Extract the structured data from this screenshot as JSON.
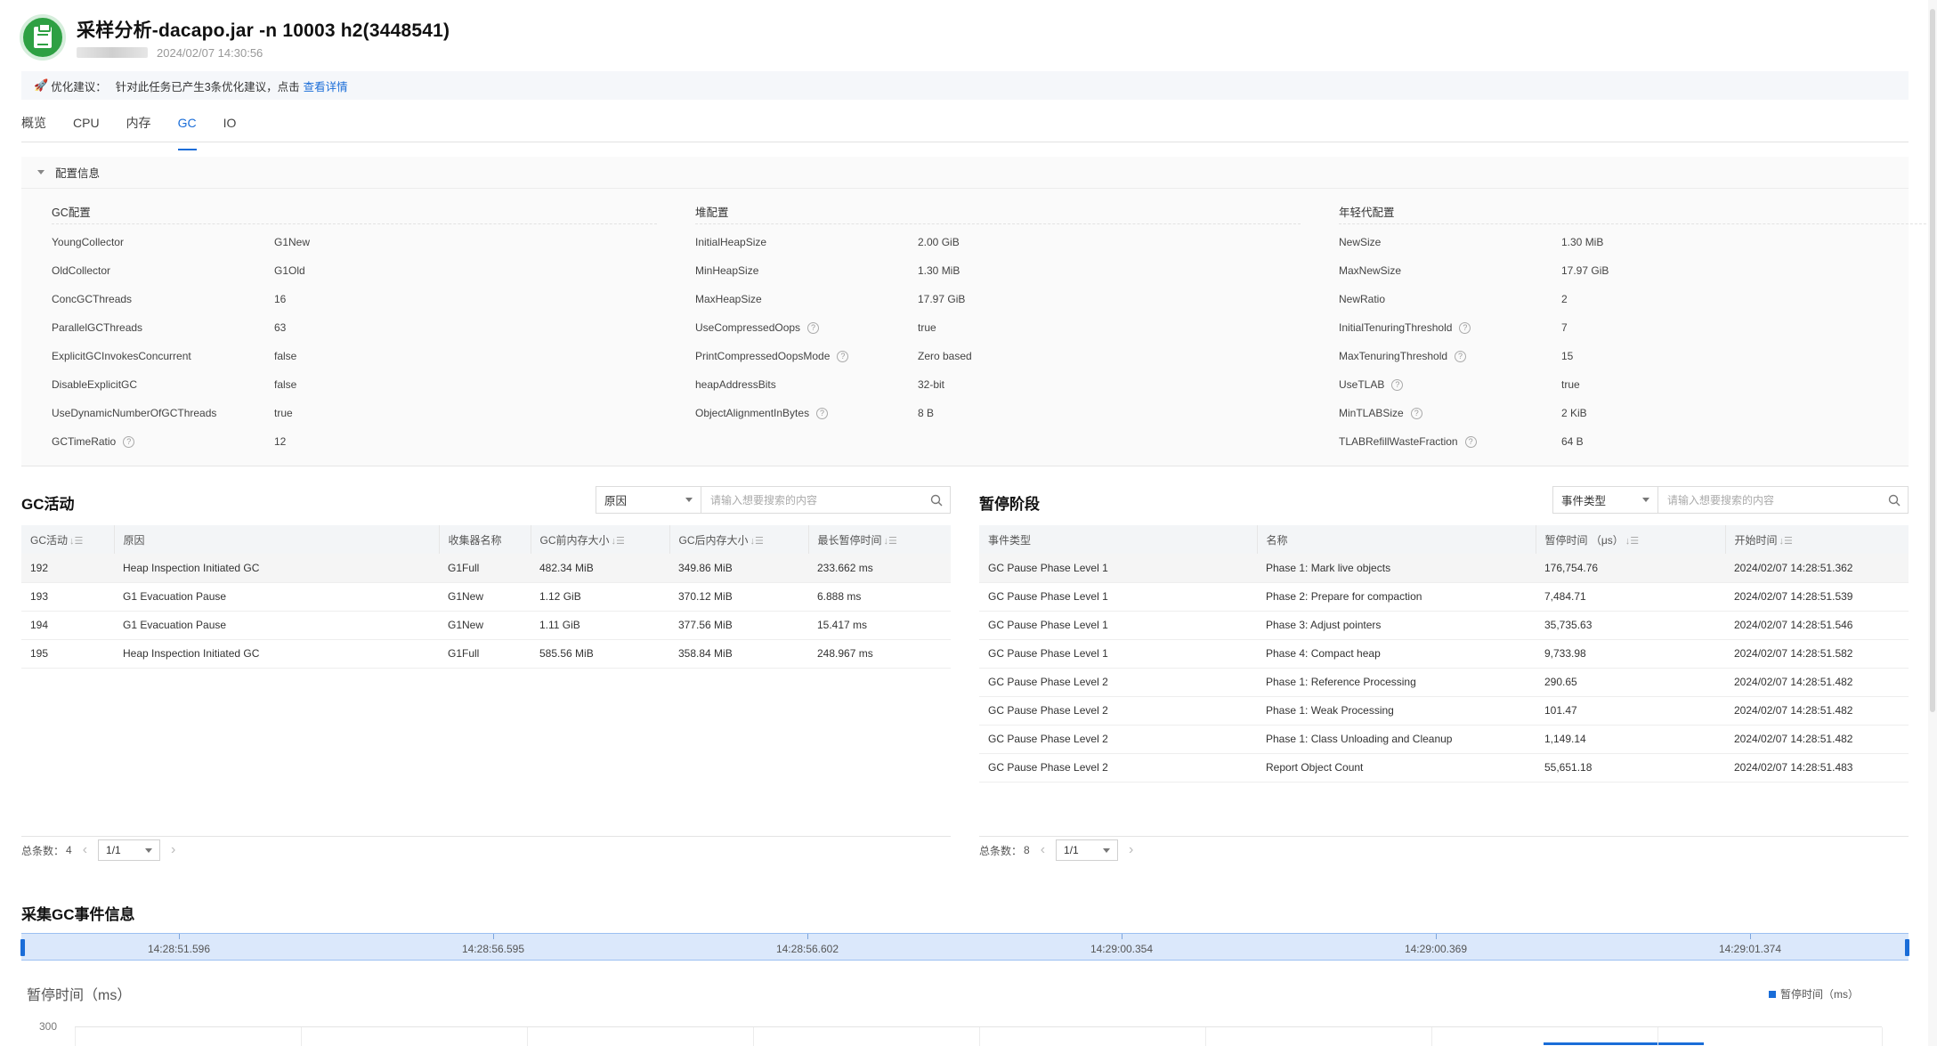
{
  "header": {
    "title": "采样分析-dacapo.jar -n 10003 h2(3448541)",
    "timestamp": "2024/02/07 14:30:56"
  },
  "suggestion": {
    "label": "优化建议：",
    "text": "针对此任务已产生3条优化建议，点击",
    "link": "查看详情"
  },
  "tabs": [
    {
      "label": "概览",
      "active": false
    },
    {
      "label": "CPU",
      "active": false
    },
    {
      "label": "内存",
      "active": false
    },
    {
      "label": "GC",
      "active": true
    },
    {
      "label": "IO",
      "active": false
    }
  ],
  "config": {
    "section_title": "配置信息",
    "gc": {
      "title": "GC配置",
      "items": [
        {
          "key": "YoungCollector",
          "value": "G1New"
        },
        {
          "key": "OldCollector",
          "value": "G1Old"
        },
        {
          "key": "ConcGCThreads",
          "value": "16"
        },
        {
          "key": "ParallelGCThreads",
          "value": "63"
        },
        {
          "key": "ExplicitGCInvokesConcurrent",
          "value": "false"
        },
        {
          "key": "DisableExplicitGC",
          "value": "false"
        },
        {
          "key": "UseDynamicNumberOfGCThreads",
          "value": "true"
        },
        {
          "key": "GCTimeRatio",
          "value": "12",
          "help": true
        }
      ]
    },
    "heap": {
      "title": "堆配置",
      "items": [
        {
          "key": "InitialHeapSize",
          "value": "2.00 GiB"
        },
        {
          "key": "MinHeapSize",
          "value": "1.30 MiB"
        },
        {
          "key": "MaxHeapSize",
          "value": "17.97 GiB"
        },
        {
          "key": "UseCompressedOops",
          "value": "true",
          "help": true
        },
        {
          "key": "PrintCompressedOopsMode",
          "value": "Zero based",
          "help": true
        },
        {
          "key": "heapAddressBits",
          "value": "32-bit"
        },
        {
          "key": "ObjectAlignmentInBytes",
          "value": "8 B",
          "help": true
        }
      ]
    },
    "young": {
      "title": "年轻代配置",
      "items": [
        {
          "key": "NewSize",
          "value": "1.30 MiB"
        },
        {
          "key": "MaxNewSize",
          "value": "17.97 GiB"
        },
        {
          "key": "NewRatio",
          "value": "2"
        },
        {
          "key": "InitialTenuringThreshold",
          "value": "7",
          "help": true
        },
        {
          "key": "MaxTenuringThreshold",
          "value": "15",
          "help": true
        },
        {
          "key": "UseTLAB",
          "value": "true",
          "help": true
        },
        {
          "key": "MinTLABSize",
          "value": "2 KiB",
          "help": true
        },
        {
          "key": "TLABRefillWasteFraction",
          "value": "64 B",
          "help": true
        }
      ]
    }
  },
  "gc_activity": {
    "title": "GC活动",
    "filter_select": "原因",
    "search_placeholder": "请输入想要搜索的内容",
    "columns": [
      {
        "label": "GC活动",
        "sortable": true
      },
      {
        "label": "原因",
        "sortable": false
      },
      {
        "label": "收集器名称",
        "sortable": false
      },
      {
        "label": "GC前内存大小",
        "sortable": true
      },
      {
        "label": "GC后内存大小",
        "sortable": true
      },
      {
        "label": "最长暂停时间",
        "sortable": true
      }
    ],
    "rows": [
      [
        "192",
        "Heap Inspection Initiated GC",
        "G1Full",
        "482.34 MiB",
        "349.86 MiB",
        "233.662 ms"
      ],
      [
        "193",
        "G1 Evacuation Pause",
        "G1New",
        "1.12 GiB",
        "370.12 MiB",
        "6.888 ms"
      ],
      [
        "194",
        "G1 Evacuation Pause",
        "G1New",
        "1.11 GiB",
        "377.56 MiB",
        "15.417 ms"
      ],
      [
        "195",
        "Heap Inspection Initiated GC",
        "G1Full",
        "585.56 MiB",
        "358.84 MiB",
        "248.967 ms"
      ]
    ],
    "total_label": "总条数：",
    "total": "4",
    "page": "1/1"
  },
  "pause_phase": {
    "title": "暂停阶段",
    "filter_select": "事件类型",
    "search_placeholder": "请输入想要搜索的内容",
    "columns": [
      {
        "label": "事件类型",
        "sortable": false
      },
      {
        "label": "名称",
        "sortable": false
      },
      {
        "label": "暂停时间 （μs）",
        "sortable": true
      },
      {
        "label": "开始时间",
        "sortable": true
      }
    ],
    "rows": [
      [
        "GC Pause Phase Level 1",
        "Phase 1: Mark live objects",
        "176,754.76",
        "2024/02/07 14:28:51.362"
      ],
      [
        "GC Pause Phase Level 1",
        "Phase 2: Prepare for compaction",
        "7,484.71",
        "2024/02/07 14:28:51.539"
      ],
      [
        "GC Pause Phase Level 1",
        "Phase 3: Adjust pointers",
        "35,735.63",
        "2024/02/07 14:28:51.546"
      ],
      [
        "GC Pause Phase Level 1",
        "Phase 4: Compact heap",
        "9,733.98",
        "2024/02/07 14:28:51.582"
      ],
      [
        "GC Pause Phase Level 2",
        "Phase 1: Reference Processing",
        "290.65",
        "2024/02/07 14:28:51.482"
      ],
      [
        "GC Pause Phase Level 2",
        "Phase 1: Weak Processing",
        "101.47",
        "2024/02/07 14:28:51.482"
      ],
      [
        "GC Pause Phase Level 2",
        "Phase 1: Class Unloading and Cleanup",
        "1,149.14",
        "2024/02/07 14:28:51.482"
      ],
      [
        "GC Pause Phase Level 2",
        "Report Object Count",
        "55,651.18",
        "2024/02/07 14:28:51.483"
      ]
    ],
    "total_label": "总条数：",
    "total": "8",
    "page": "1/1"
  },
  "gc_events": {
    "title": "采集GC事件信息",
    "timeline_labels": [
      "14:28:51.596",
      "14:28:56.595",
      "14:28:56.602",
      "14:29:00.354",
      "14:29:00.369",
      "14:29:01.374"
    ],
    "chart_title": "暂停时间（ms）",
    "legend": "暂停时间（ms）",
    "y_tick": "300"
  }
}
